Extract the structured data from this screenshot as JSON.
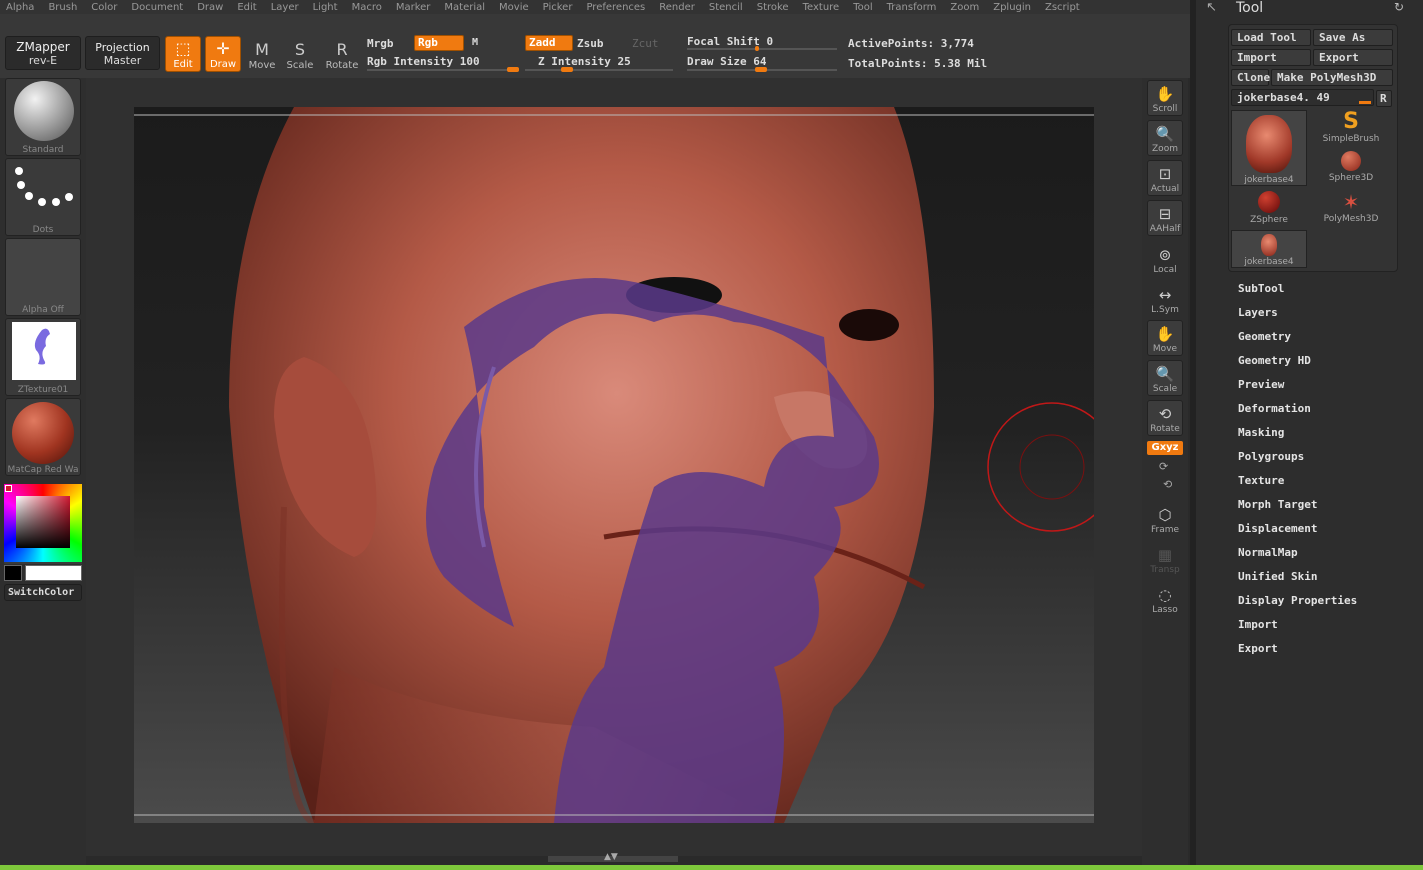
{
  "menu": [
    "Alpha",
    "Brush",
    "Color",
    "Document",
    "Draw",
    "Edit",
    "Layer",
    "Light",
    "Macro",
    "Marker",
    "Material",
    "Movie",
    "Picker",
    "Preferences",
    "Render",
    "Stencil",
    "Stroke",
    "Texture",
    "Tool",
    "Transform",
    "Zoom",
    "Zplugin",
    "Zscript"
  ],
  "toolbar": {
    "zmapper_line1": "ZMapper",
    "zmapper_line2": "rev-E",
    "projection_line1": "Projection",
    "projection_line2": "Master",
    "edit_label": "Edit",
    "draw_label": "Draw",
    "move_label": "Move",
    "scale_label": "Scale",
    "rotate_label": "Rotate",
    "mrgb": "Mrgb",
    "rgb": "Rgb",
    "m": "M",
    "rgb_intensity": "Rgb Intensity 100",
    "rgb_intensity_value": 100,
    "zadd": "Zadd",
    "zsub": "Zsub",
    "zcut": "Zcut",
    "z_intensity": "Z Intensity 25",
    "z_intensity_value": 25,
    "focal_shift": "Focal Shift 0",
    "focal_shift_value": 0,
    "draw_size": "Draw Size 64",
    "draw_size_value": 64,
    "active_points": "ActivePoints: 3,774",
    "total_points": "TotalPoints: 5.38 Mil"
  },
  "left_shelf": {
    "brush": "Standard",
    "stroke": "Dots",
    "alpha": "Alpha Off",
    "texture": "ZTexture01",
    "material": "MatCap Red Wa",
    "switch_color": "SwitchColor"
  },
  "right_shelf": {
    "scroll": "Scroll",
    "zoom": "Zoom",
    "actual": "Actual",
    "aahalf": "AAHalf",
    "local": "Local",
    "lsym": "L.Sym",
    "move": "Move",
    "scale": "Scale",
    "rotate": "Rotate",
    "xyz": "Gxyz",
    "frame": "Frame",
    "transp": "Transp",
    "lasso": "Lasso"
  },
  "tool_palette": {
    "title": "Tool",
    "load_tool": "Load Tool",
    "save_as": "Save As",
    "import": "Import",
    "export": "Export",
    "clone": "Clone",
    "make_polymesh": "Make PolyMesh3D",
    "current_tool": "jokerbase4. 49",
    "r_button": "R",
    "thumbs": [
      "jokerbase4",
      "SimpleBrush",
      "Sphere3D",
      "ZSphere",
      "PolyMesh3D",
      "jokerbase4"
    ],
    "sections": [
      "SubTool",
      "Layers",
      "Geometry",
      "Geometry HD",
      "Preview",
      "Deformation",
      "Masking",
      "Polygroups",
      "Texture",
      "Morph Target",
      "Displacement",
      "NormalMap",
      "Unified Skin",
      "Display Properties",
      "Import",
      "Export"
    ]
  },
  "colors": {
    "accent": "#f07a10",
    "primary_color": "#ffffff",
    "secondary_color": "#000000",
    "bottom_bar": "#7ec83b"
  }
}
